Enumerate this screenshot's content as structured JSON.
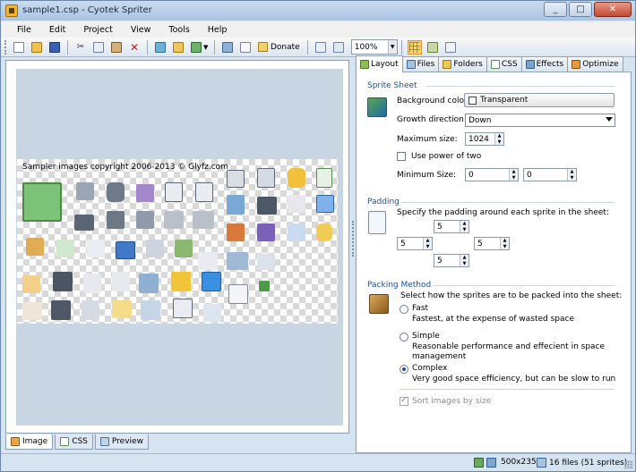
{
  "window": {
    "title": "sample1.csp - Cyotek Spriter"
  },
  "menu": [
    "File",
    "Edit",
    "Project",
    "View",
    "Tools",
    "Help"
  ],
  "toolbar": {
    "donate_label": "Donate",
    "zoom_value": "100%"
  },
  "canvas": {
    "caption": "Sampler images copyright 2006-2013 © Glyfz.com"
  },
  "bottom_tabs": [
    {
      "label": "Image",
      "icon": "image-icon"
    },
    {
      "label": "CSS",
      "icon": "css-icon"
    },
    {
      "label": "Preview",
      "icon": "preview-icon"
    }
  ],
  "tabs": [
    {
      "label": "Layout",
      "icon": "layout-icon"
    },
    {
      "label": "Files",
      "icon": "files-icon"
    },
    {
      "label": "Folders",
      "icon": "folders-icon"
    },
    {
      "label": "CSS",
      "icon": "css-icon"
    },
    {
      "label": "Effects",
      "icon": "effects-icon"
    },
    {
      "label": "Optimize",
      "icon": "optimize-icon"
    }
  ],
  "sprite_sheet": {
    "title": "Sprite Sheet",
    "background_color_label": "Background color:",
    "background_color_value": "Transparent",
    "growth_direction_label": "Growth direction:",
    "growth_direction_value": "Down",
    "maximum_size_label": "Maximum size:",
    "maximum_size_value": "1024",
    "power_of_two_label": "Use power of two",
    "minimum_size_label": "Minimum Size:",
    "minimum_width": "0",
    "minimum_height": "0"
  },
  "padding": {
    "title": "Padding",
    "description": "Specify the padding around each sprite in the sheet:",
    "top": "5",
    "left": "5",
    "right": "5",
    "bottom": "5"
  },
  "packing": {
    "title": "Packing Method",
    "description": "Select how the sprites are to be packed into the sheet:",
    "options": [
      {
        "label": "Fast",
        "description": "Fastest, at the expense of wasted space",
        "selected": false
      },
      {
        "label": "Simple",
        "description": "Reasonable performance and effecient in space",
        "description2": "management",
        "selected": false
      },
      {
        "label": "Complex",
        "description": "Very good space efficiency, but can be slow to run",
        "selected": true
      }
    ],
    "sort_label": "Sort images by size"
  },
  "status": {
    "dimensions": "500x235",
    "files": "16 files (51 sprites)"
  }
}
